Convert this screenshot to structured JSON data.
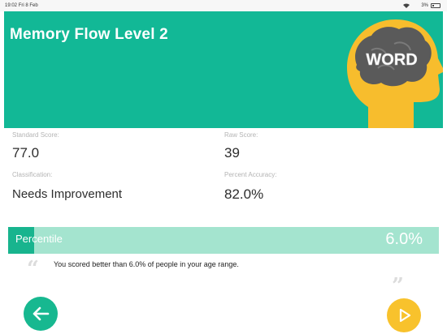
{
  "status_bar": {
    "time": "19:02",
    "date": "Fri 8 Feb",
    "battery": "3%"
  },
  "header": {
    "title": "Memory Flow Level 2",
    "logo_text": "WORD",
    "background_color": "#12b896"
  },
  "stats": {
    "standard_score": {
      "label": "Standard Score:",
      "value": "77.0"
    },
    "raw_score": {
      "label": "Raw Score:",
      "value": "39"
    },
    "classification": {
      "label": "Classification:",
      "value": "Needs Improvement"
    },
    "percent_accuracy": {
      "label": "Percent Accuracy:",
      "value": "82.0%"
    }
  },
  "percentile": {
    "label": "Percentile",
    "value_text": "6.0%",
    "value": 6.0
  },
  "message": {
    "text": "You scored better than 6.0% of people in your age range."
  },
  "navigation": {
    "back_icon": "arrow-left-icon",
    "next_icon": "play-triangle-icon",
    "back_color": "#17b890",
    "next_color": "#f8c22c"
  }
}
